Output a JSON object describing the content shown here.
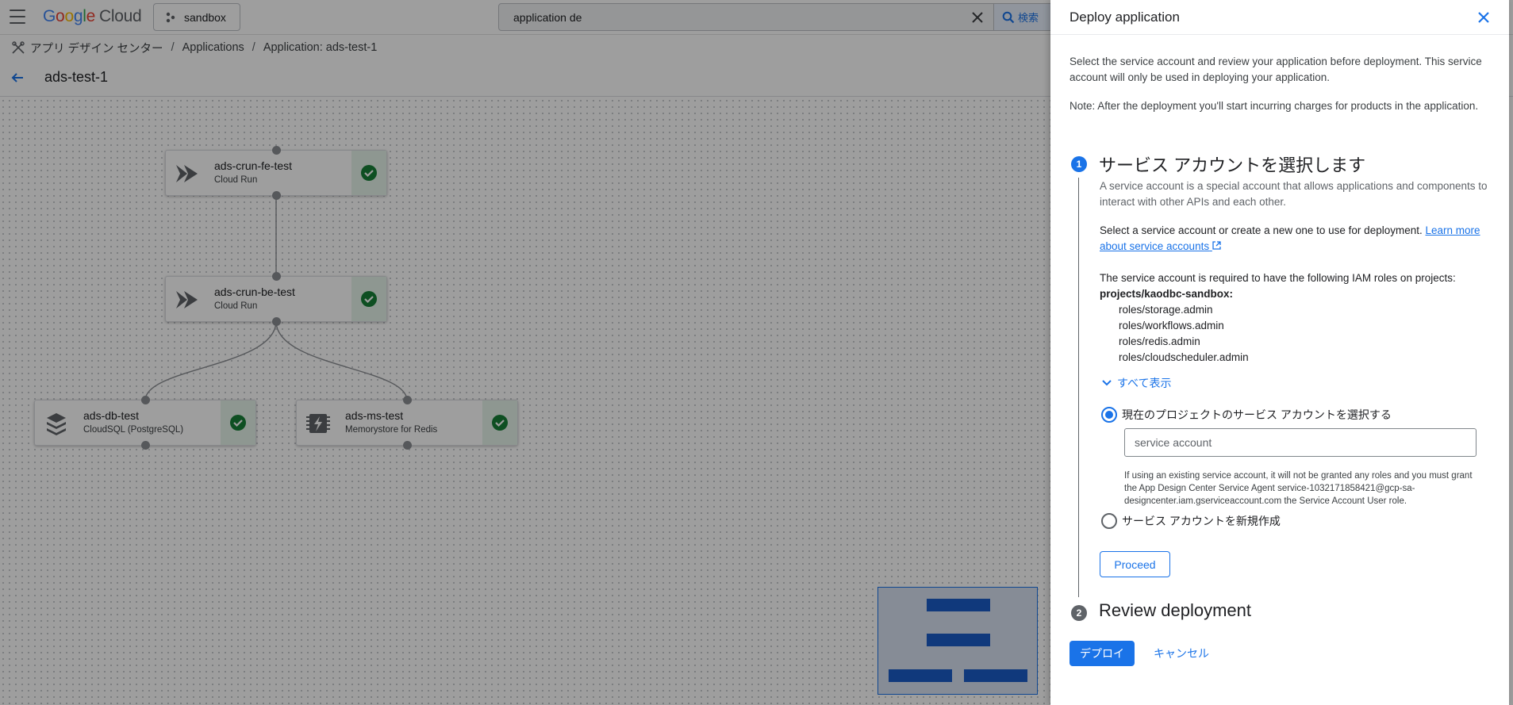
{
  "header": {
    "logo_google": "Google",
    "logo_cloud": "Cloud",
    "project": "sandbox",
    "search_value": "application de",
    "search_button": "検索"
  },
  "breadcrumb": {
    "root": "アプリ デザイン センター",
    "applications": "Applications",
    "current": "Application:  ads-test-1"
  },
  "page": {
    "title": "ads-test-1"
  },
  "canvas": {
    "nodes": [
      {
        "title": "ads-crun-fe-test",
        "subtitle": "Cloud Run",
        "icon": "cloud-run-icon",
        "status": "ok"
      },
      {
        "title": "ads-crun-be-test",
        "subtitle": "Cloud Run",
        "icon": "cloud-run-icon",
        "status": "ok"
      },
      {
        "title": "ads-db-test",
        "subtitle": "CloudSQL (PostgreSQL)",
        "icon": "cloudsql-icon",
        "status": "ok"
      },
      {
        "title": "ads-ms-test",
        "subtitle": "Memorystore for Redis",
        "icon": "memorystore-icon",
        "status": "ok"
      }
    ]
  },
  "panel": {
    "title": "Deploy application",
    "intro": "Select the service account and review your application before deployment. This service account will only be used in deploying your application.",
    "note": "Note: After the deployment you'll start incurring charges for products in the application.",
    "step1": {
      "number": "1",
      "title": "サービス アカウントを選択します",
      "description": "A service account is a special account that allows applications and components to interact with other APIs and each other.",
      "select_text": "Select a service account or create a new one to use for deployment.",
      "learn_more": "Learn more about service accounts",
      "roles_intro": "The service account is required to have the following IAM roles on projects:",
      "project_path": "projects/kaodbc-sandbox:",
      "roles": [
        "roles/storage.admin",
        "roles/workflows.admin",
        "roles/redis.admin",
        "roles/cloudscheduler.admin"
      ],
      "show_all": "すべて表示",
      "option_existing": "現在のプロジェクトのサービス アカウントを選択する",
      "input_placeholder": "service account",
      "hint": "If using an existing service account, it will not be granted any roles and you must grant the App Design Center Service Agent service-1032171858421@gcp-sa-designcenter.iam.gserviceaccount.com the Service Account User role.",
      "option_new": "サービス アカウントを新規作成",
      "proceed": "Proceed"
    },
    "step2": {
      "number": "2",
      "title": "Review deployment"
    },
    "deploy": "デプロイ",
    "cancel": "キャンセル"
  },
  "colors": {
    "accent": "#1a73e8",
    "success": "#188038",
    "step_inactive": "#5f6368"
  }
}
